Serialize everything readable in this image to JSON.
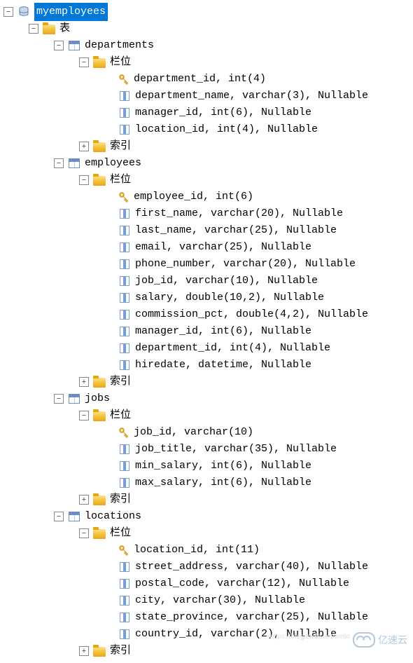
{
  "database": "myemployees",
  "tablesFolder": "表",
  "columnsFolder": "栏位",
  "indexesFolder": "索引",
  "tables": [
    {
      "name": "departments",
      "columns": [
        {
          "pk": true,
          "text": "department_id, int(4)"
        },
        {
          "pk": false,
          "text": "department_name, varchar(3), Nullable"
        },
        {
          "pk": false,
          "text": "manager_id, int(6), Nullable"
        },
        {
          "pk": false,
          "text": "location_id, int(4), Nullable"
        }
      ]
    },
    {
      "name": "employees",
      "columns": [
        {
          "pk": true,
          "text": "employee_id, int(6)"
        },
        {
          "pk": false,
          "text": "first_name, varchar(20), Nullable"
        },
        {
          "pk": false,
          "text": "last_name, varchar(25), Nullable"
        },
        {
          "pk": false,
          "text": "email, varchar(25), Nullable"
        },
        {
          "pk": false,
          "text": "phone_number, varchar(20), Nullable"
        },
        {
          "pk": false,
          "text": "job_id, varchar(10), Nullable"
        },
        {
          "pk": false,
          "text": "salary, double(10,2), Nullable"
        },
        {
          "pk": false,
          "text": "commission_pct, double(4,2), Nullable"
        },
        {
          "pk": false,
          "text": "manager_id, int(6), Nullable"
        },
        {
          "pk": false,
          "text": "department_id, int(4), Nullable"
        },
        {
          "pk": false,
          "text": "hiredate, datetime, Nullable"
        }
      ]
    },
    {
      "name": "jobs",
      "columns": [
        {
          "pk": true,
          "text": "job_id, varchar(10)"
        },
        {
          "pk": false,
          "text": "job_title, varchar(35), Nullable"
        },
        {
          "pk": false,
          "text": "min_salary, int(6), Nullable"
        },
        {
          "pk": false,
          "text": "max_salary, int(6), Nullable"
        }
      ]
    },
    {
      "name": "locations",
      "columns": [
        {
          "pk": true,
          "text": "location_id, int(11)"
        },
        {
          "pk": false,
          "text": "street_address, varchar(40), Nullable"
        },
        {
          "pk": false,
          "text": "postal_code, varchar(12), Nullable"
        },
        {
          "pk": false,
          "text": "city, varchar(30), Nullable"
        },
        {
          "pk": false,
          "text": "state_province, varchar(25), Nullable"
        },
        {
          "pk": false,
          "text": "country_id, varchar(2), Nullable"
        }
      ]
    }
  ],
  "watermark": "亿速云",
  "blogWatermark": "https://blog.csdn.net/weixi"
}
